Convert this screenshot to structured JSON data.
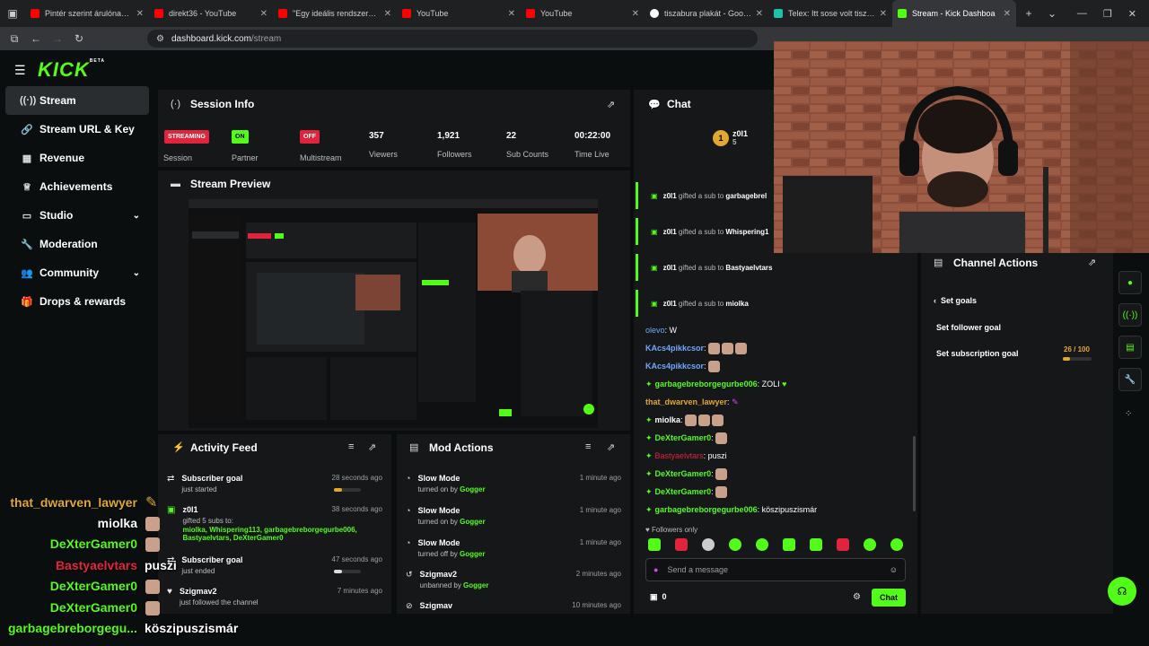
{
  "browser": {
    "tabs": [
      {
        "title": "Pintér szerint árulónak tartj",
        "color": "#ff0000"
      },
      {
        "title": "direkt36 - YouTube",
        "color": "#ff0000"
      },
      {
        "title": "\"Egy ideális rendszerben ne",
        "color": "#ff0000"
      },
      {
        "title": "YouTube",
        "color": "#ff0000"
      },
      {
        "title": "YouTube",
        "color": "#ff0000"
      },
      {
        "title": "tiszabura plakát - Google-k",
        "color": "#ffffff"
      },
      {
        "title": "Telex: Itt sose volt tiszta a v",
        "color": "#21c0a8"
      },
      {
        "title": "Stream - Kick Dashboa",
        "color": "#53fc18"
      }
    ],
    "url_host": "dashboard.kick.com",
    "url_path": "/stream"
  },
  "brand": {
    "logo": "KICK",
    "beta": "BETA",
    "accent": "#53fc18"
  },
  "sidebar": {
    "items": [
      {
        "label": "Stream",
        "icon": "broadcast-icon"
      },
      {
        "label": "Stream URL & Key",
        "icon": "link-icon"
      },
      {
        "label": "Revenue",
        "icon": "chart-icon"
      },
      {
        "label": "Achievements",
        "icon": "trophy-icon"
      },
      {
        "label": "Studio",
        "icon": "monitor-icon"
      },
      {
        "label": "Moderation",
        "icon": "wrench-icon"
      },
      {
        "label": "Community",
        "icon": "users-icon"
      },
      {
        "label": "Drops & rewards",
        "icon": "gift-icon"
      }
    ]
  },
  "session": {
    "title": "Session Info",
    "streaming_badge": "STREAMING",
    "partner_badge": "ON",
    "multistream_badge": "OFF",
    "session_label": "Session",
    "partner_label": "Partner",
    "multistream_label": "Multistream",
    "viewers": "357",
    "viewers_label": "Viewers",
    "followers": "1,921",
    "followers_label": "Followers",
    "subs": "22",
    "subs_label": "Sub Counts",
    "time": "00:22:00",
    "time_label": "Time Live"
  },
  "preview": {
    "title": "Stream Preview"
  },
  "activity": {
    "title": "Activity Feed",
    "rows": [
      {
        "title": "Subscriber goal",
        "sub": "just started",
        "time": "28 seconds ago"
      },
      {
        "title": "z0l1",
        "sub": "gifted 5 subs to:",
        "names": "miolka, Whispering113, garbagebreborgegurbe006, Bastyaelvtars, DeXterGamer0",
        "time": "38 seconds ago"
      },
      {
        "title": "Subscriber goal",
        "sub": "just ended",
        "time": "47 seconds ago"
      },
      {
        "title": "Szigmav2",
        "sub": "just followed the channel",
        "time": "7 minutes ago"
      }
    ]
  },
  "mod": {
    "title": "Mod Actions",
    "rows": [
      {
        "title": "Slow Mode",
        "sub": "turned on by",
        "user": "Gogger",
        "time": "1 minute ago"
      },
      {
        "title": "Slow Mode",
        "sub": "turned on by",
        "user": "Gogger",
        "time": "1 minute ago"
      },
      {
        "title": "Slow Mode",
        "sub": "turned off by",
        "user": "Gogger",
        "time": "1 minute ago"
      },
      {
        "title": "Szigmav2",
        "sub": "unbanned by",
        "user": "Gogger",
        "time": "2 minutes ago"
      },
      {
        "title": "Szigmav",
        "sub": "",
        "user": "",
        "time": "10 minutes ago"
      }
    ]
  },
  "chat": {
    "title": "Chat",
    "top_user": "z0l1",
    "top_count": "5",
    "gifts": [
      {
        "user": "z0l1",
        "text": "gifted a sub to",
        "target": "garbagebrel"
      },
      {
        "user": "z0l1",
        "text": "gifted a sub to",
        "target": "Whispering1"
      },
      {
        "user": "z0l1",
        "text": "gifted a sub to",
        "target": "Bastyaelvtars"
      },
      {
        "user": "z0l1",
        "text": "gifted a sub to",
        "target": "miolka"
      }
    ],
    "messages": [
      {
        "user": "olevo",
        "color": "#6fa8ff",
        "text": "W"
      },
      {
        "user": "KAcs4pikkcsor",
        "color": "#6fa8ff",
        "text": ""
      },
      {
        "user": "KAcs4pikkcsor",
        "color": "#6fa8ff",
        "text": ""
      },
      {
        "user": "garbagebreborgegurbe006",
        "color": "#53fc18",
        "text": "ZOLI"
      },
      {
        "user": "that_dwarven_lawyer",
        "color": "#e0a82e",
        "text": ""
      },
      {
        "user": "miolka",
        "color": "#ffffff",
        "text": ""
      },
      {
        "user": "DeXterGamer0",
        "color": "#53fc18",
        "text": ""
      },
      {
        "user": "Bastyaelvtars",
        "color": "#e0243b",
        "text": "puszi"
      },
      {
        "user": "DeXterGamer0",
        "color": "#53fc18",
        "text": ""
      },
      {
        "user": "DeXterGamer0",
        "color": "#53fc18",
        "text": ""
      },
      {
        "user": "garbagebreborgegurbe006",
        "color": "#53fc18",
        "text": "köszipuszismár"
      }
    ],
    "followers_only": "Followers only",
    "placeholder": "Send a message",
    "points": "0",
    "send_label": "Chat"
  },
  "channel_actions": {
    "title": "Channel Actions",
    "back_label": "Set goals",
    "follower_goal": "Set follower goal",
    "sub_goal": "Set subscription goal",
    "sub_progress": "26 / 100",
    "sub_progress_value": 26,
    "sub_progress_max": 100
  },
  "overlay": {
    "lines": [
      {
        "user": "that_dwarven_lawyer",
        "color": "#e0a82e",
        "text": ""
      },
      {
        "user": "miolka",
        "color": "#ffffff",
        "text": ""
      },
      {
        "user": "DeXterGamer0",
        "color": "#53fc18",
        "text": ""
      },
      {
        "user": "Bastyaelvtars",
        "color": "#e0243b",
        "text": "puszi"
      },
      {
        "user": "DeXterGamer0",
        "color": "#53fc18",
        "text": ""
      },
      {
        "user": "DeXterGamer0",
        "color": "#53fc18",
        "text": ""
      },
      {
        "user": "garbagebreborgegu...",
        "color": "#53fc18",
        "text": "köszipuszismár"
      }
    ]
  }
}
